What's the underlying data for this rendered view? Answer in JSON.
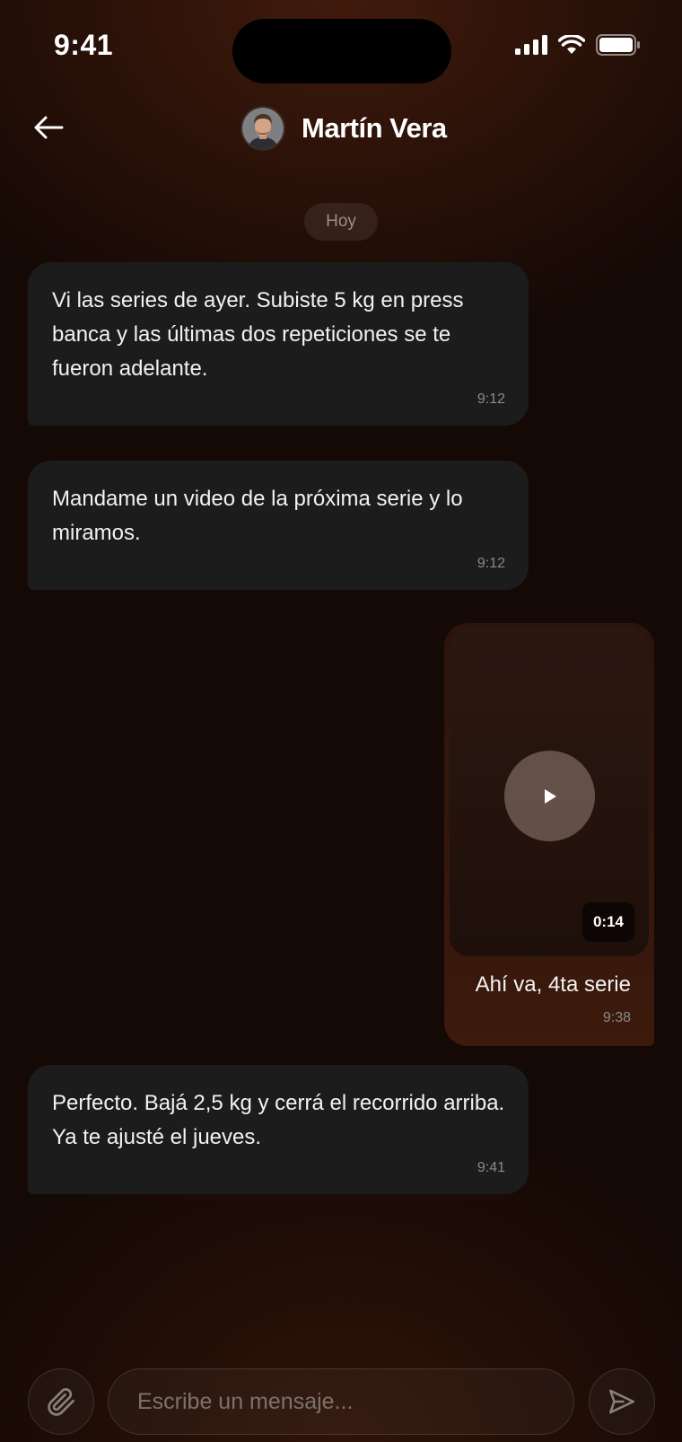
{
  "status_bar": {
    "time": "9:41"
  },
  "header": {
    "contact_name": "Martín Vera"
  },
  "date_separator": "Hoy",
  "messages": [
    {
      "direction": "incoming",
      "text": "Vi las series de ayer. Subiste 5 kg en press banca y las últimas dos repeticiones se te fueron adelante.",
      "time": "9:12"
    },
    {
      "direction": "incoming",
      "text": "Mandame un video de la próxima serie y lo miramos.",
      "time": "9:12"
    },
    {
      "direction": "outgoing",
      "video_duration": "0:14",
      "text": "Ahí va, 4ta serie",
      "time": "9:38"
    },
    {
      "direction": "incoming",
      "text": "Perfecto. Bajá 2,5 kg y cerrá el recorrido arriba. Ya te ajusté el jueves.",
      "time": "9:41"
    }
  ],
  "composer": {
    "placeholder": "Escribe un mensaje..."
  },
  "icons": {
    "back": "arrow-left-icon",
    "attach": "paperclip-icon",
    "send": "send-icon",
    "play": "play-icon",
    "signal": "cellular-signal-icon",
    "wifi": "wifi-icon",
    "battery": "battery-icon"
  },
  "colors": {
    "incoming_bubble": "#1c1c1c",
    "outgoing_bubble": "#3c1a0c",
    "background": "#150905"
  }
}
